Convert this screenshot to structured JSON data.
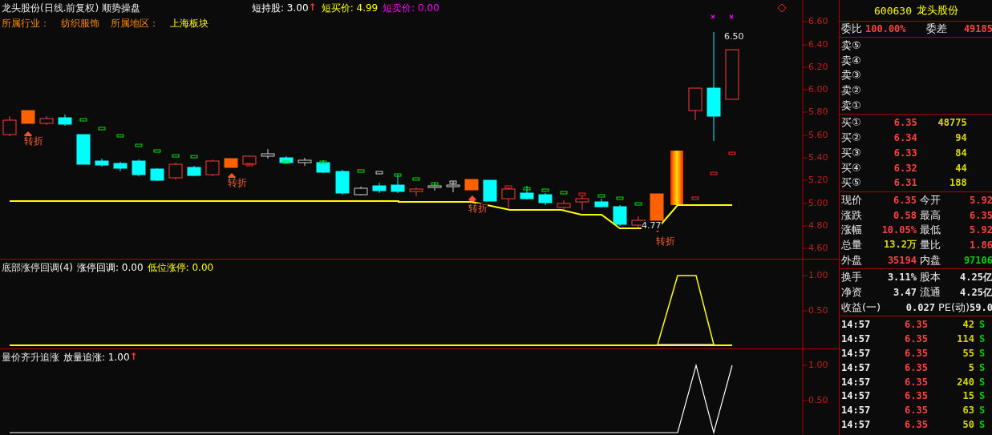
{
  "main_chart": {
    "title": "龙头股份(日线.前复权) 顺势操盘",
    "signals": [
      {
        "label": "短持股: 3.00",
        "color": "#ffffff",
        "arrow": "↑"
      },
      {
        "label": "短买价: 4.99",
        "color": "#ffff00"
      },
      {
        "label": "短卖价: 0.00",
        "color": "#ff00ff"
      }
    ],
    "info": [
      {
        "label": "所属行业：",
        "value": "纺织服饰"
      },
      {
        "label": "所属地区：",
        "value": "上海板块"
      }
    ],
    "annotations": [
      "转折",
      "转折",
      "转折",
      "转折"
    ],
    "price_labels": [
      "6.50",
      "4.77"
    ],
    "y_ticks": [
      "6.60",
      "6.40",
      "6.20",
      "6.00",
      "5.80",
      "5.60",
      "5.40",
      "5.20",
      "5.00",
      "4.80",
      "4.60"
    ]
  },
  "indicator_1": {
    "title": "底部涨停回调(4)",
    "values": [
      {
        "label": "涨停回调: 0.00",
        "color": "#ffffff"
      },
      {
        "label": "低位涨停: 0.00",
        "color": "#ffff00"
      }
    ],
    "y_ticks": [
      "1.00",
      "0.50"
    ]
  },
  "indicator_2": {
    "title": "量价齐升追涨",
    "values": [
      {
        "label": "放量追涨: 1.00",
        "color": "#ffffff",
        "arrow": "↑"
      }
    ],
    "y_ticks": [
      "1.00",
      "0.50"
    ]
  },
  "quote": {
    "code": "600630",
    "name": "龙头股份",
    "order_ratio": {
      "label": "委比",
      "value": "100.00%",
      "diff_label": "委差",
      "diff": "49185"
    },
    "asks": [
      {
        "label": "卖⑤"
      },
      {
        "label": "卖④"
      },
      {
        "label": "卖③"
      },
      {
        "label": "卖②"
      },
      {
        "label": "卖①"
      }
    ],
    "bids": [
      {
        "label": "买①",
        "price": "6.35",
        "volume": "48775"
      },
      {
        "label": "买②",
        "price": "6.34",
        "volume": "94"
      },
      {
        "label": "买③",
        "price": "6.33",
        "volume": "84"
      },
      {
        "label": "买④",
        "price": "6.32",
        "volume": "44"
      },
      {
        "label": "买⑤",
        "price": "6.31",
        "volume": "188"
      }
    ],
    "stats": [
      [
        {
          "label": "现价",
          "value": "6.35",
          "color": "#ff4040"
        },
        {
          "label": "今开",
          "value": "5.92",
          "color": "#ff4040"
        }
      ],
      [
        {
          "label": "涨跌",
          "value": "0.58",
          "color": "#ff4040"
        },
        {
          "label": "最高",
          "value": "6.35",
          "color": "#ff4040"
        }
      ],
      [
        {
          "label": "涨幅",
          "value": "10.05%",
          "color": "#ff4040"
        },
        {
          "label": "最低",
          "value": "5.92",
          "color": "#ff4040"
        }
      ],
      [
        {
          "label": "总量",
          "value": "13.2万",
          "color": "#d8d800"
        },
        {
          "label": "量比",
          "value": "1.86",
          "color": "#ff4040"
        }
      ],
      [
        {
          "label": "外盘",
          "value": "35194",
          "color": "#ff4040"
        },
        {
          "label": "内盘",
          "value": "97106",
          "color": "#00d000"
        }
      ]
    ],
    "fundamentals": [
      [
        {
          "label": "换手",
          "value": "3.11%"
        },
        {
          "label": "股本",
          "value": "4.25亿"
        }
      ],
      [
        {
          "label": "净资",
          "value": "3.47"
        },
        {
          "label": "流通",
          "value": "4.25亿"
        }
      ],
      [
        {
          "label": "收益(一)",
          "value": "0.027"
        },
        {
          "label": "PE(动)",
          "value": "59.0"
        }
      ]
    ],
    "trades": [
      {
        "time": "14:57",
        "price": "6.35",
        "volume": "42",
        "side": "S"
      },
      {
        "time": "14:57",
        "price": "6.35",
        "volume": "114",
        "side": "S"
      },
      {
        "time": "14:57",
        "price": "6.35",
        "volume": "55",
        "side": "S"
      },
      {
        "time": "14:57",
        "price": "6.35",
        "volume": "5",
        "side": "S"
      },
      {
        "time": "14:57",
        "price": "6.35",
        "volume": "240",
        "side": "S"
      },
      {
        "time": "14:57",
        "price": "6.35",
        "volume": "15",
        "side": "S"
      },
      {
        "time": "14:57",
        "price": "6.35",
        "volume": "63",
        "side": "S"
      },
      {
        "time": "14:57",
        "price": "6.35",
        "volume": "50",
        "side": "S"
      }
    ]
  }
}
